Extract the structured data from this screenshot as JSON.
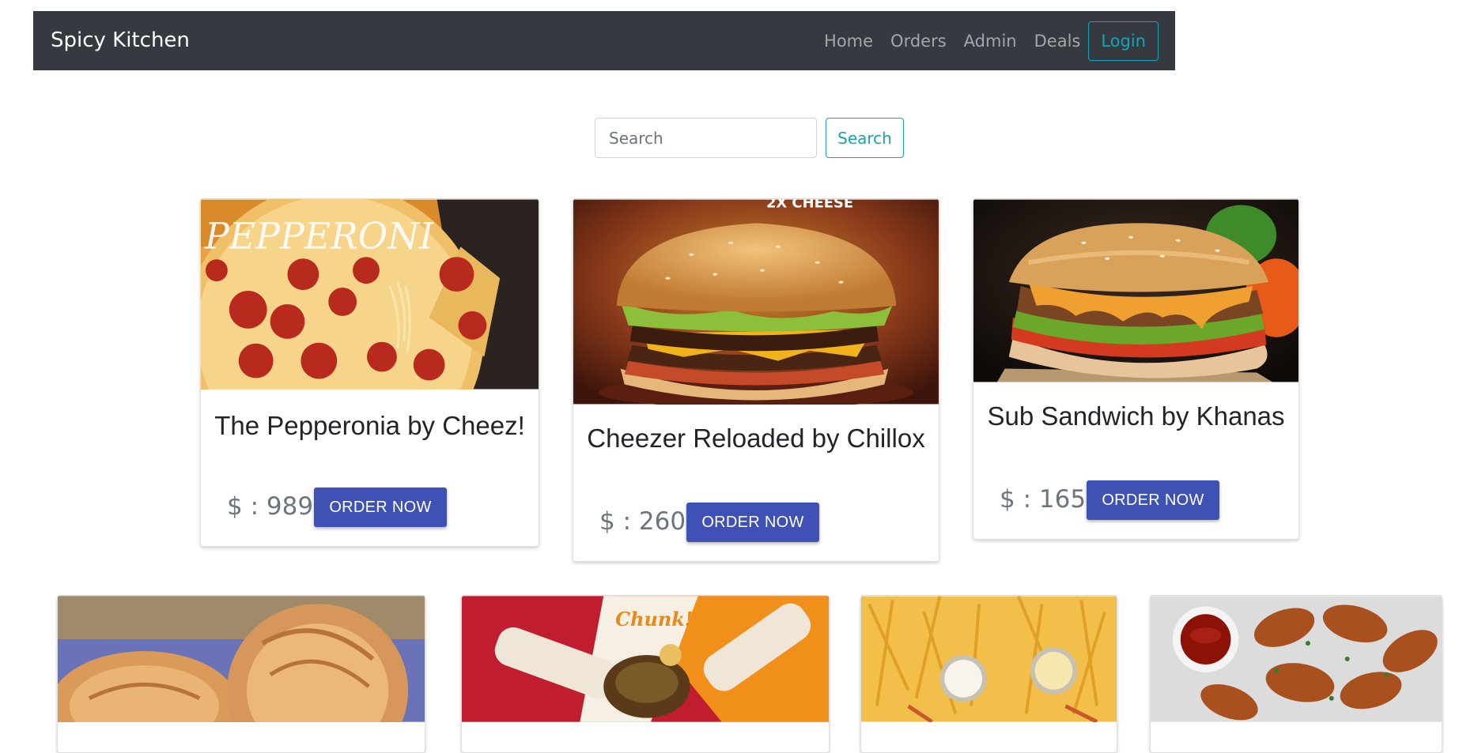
{
  "navbar": {
    "brand": "Spicy Kitchen",
    "links": [
      "Home",
      "Orders",
      "Admin",
      "Deals"
    ],
    "login_label": "Login"
  },
  "search": {
    "placeholder": "Search",
    "button_label": "Search"
  },
  "products": [
    {
      "title": "The Pepperonia by Cheez!",
      "price": "$ : 989",
      "button": "ORDER NOW"
    },
    {
      "title": "Cheezer Reloaded by Chillox",
      "price": "$ : 260",
      "button": "ORDER NOW"
    },
    {
      "title": "Sub Sandwich by Khanas",
      "price": "$ : 165",
      "button": "ORDER NOW"
    }
  ],
  "colors": {
    "navbar_bg": "#343a40",
    "accent_teal": "#17a2b8",
    "order_button": "#3f51b5"
  }
}
